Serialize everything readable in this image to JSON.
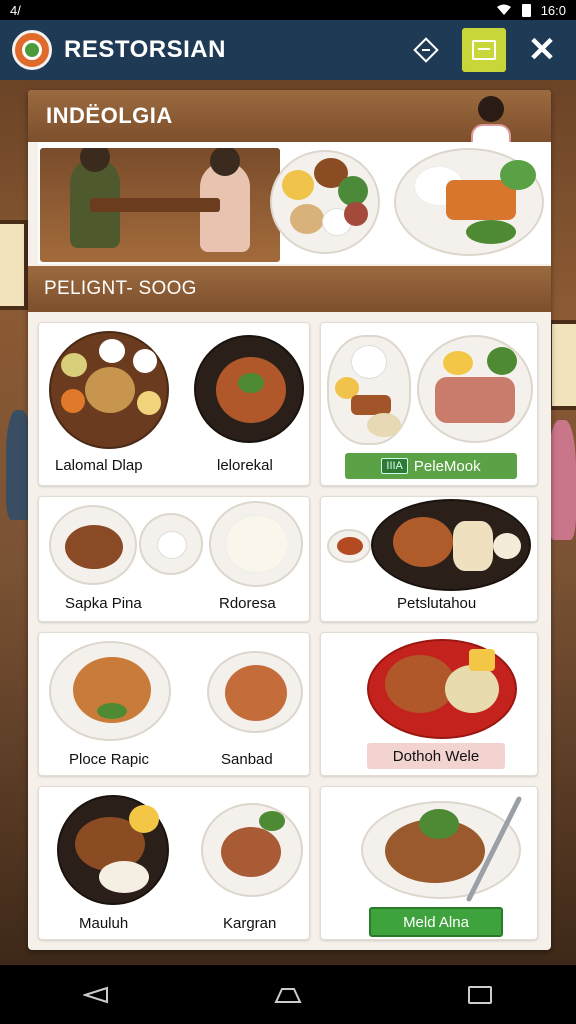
{
  "status_bar": {
    "left": "4/",
    "time": "16:0"
  },
  "app_bar": {
    "title": "RESTORSIAN"
  },
  "banner": {
    "title": "INDЁOLGIA"
  },
  "section": {
    "title": "PELIGNT- SOOG"
  },
  "dishes": [
    {
      "label": "Lalomal Dlap"
    },
    {
      "label": "lelorekal"
    },
    {
      "label": "PeleMook",
      "badge": "IIIA",
      "tag_color": "#5aa245"
    },
    {
      "label": "Sapka Pina"
    },
    {
      "label": "Rdoresa"
    },
    {
      "label": "Petslutahou"
    },
    {
      "label": "Ploce Rapic"
    },
    {
      "label": "Sanbad"
    },
    {
      "label": "Dothoh Wele",
      "tag_color": "#f2d3d0"
    },
    {
      "label": "Mauluh"
    },
    {
      "label": "Kargran"
    },
    {
      "label": "Meld Alna",
      "tag_color": "#3fa33d"
    }
  ],
  "colors": {
    "app_bar": "#1f3a55",
    "accent_brown": "#8b5a33",
    "gallery_button": "#c9d63a",
    "logo_orange": "#e06a2a"
  }
}
